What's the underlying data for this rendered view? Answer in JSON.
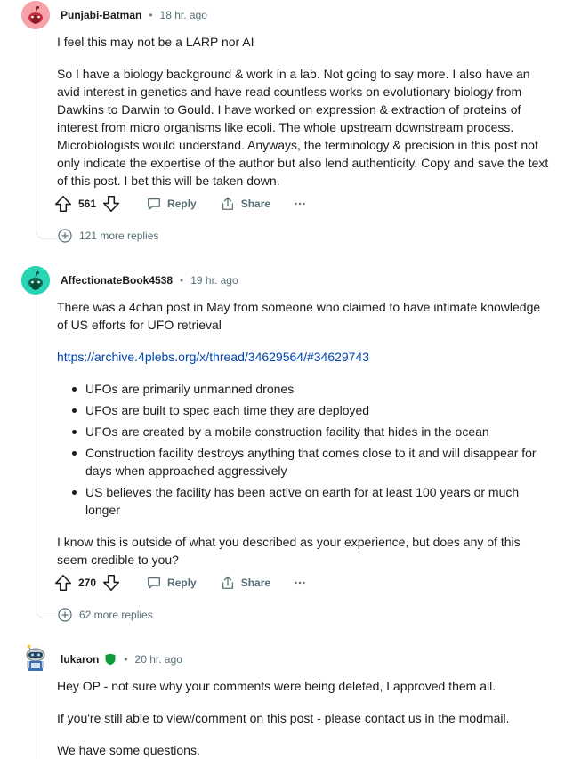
{
  "comments": [
    {
      "author": "Punjabi-Batman",
      "time": "18 hr. ago",
      "paragraphs": [
        "I feel this may not be a LARP nor AI",
        "So I have a biology background & work in a lab. Not going to say more. I also have an avid interest in genetics and have read countless works on evolutionary biology from Dawkins to Darwin to Gould. I have worked on expression & extraction of proteins of interest from micro organisms like ecoli. The whole upstream downstream process. Microbiologists would understand. Anyways, the terminology & precision in this post not only indicate the expertise of the author but also lend authenticity. Copy and save the text of this post. I bet this will be taken down."
      ],
      "votes": "561",
      "reply_label": "Reply",
      "share_label": "Share",
      "more_replies": "121 more replies",
      "avatar_color": "#f7a1a8"
    },
    {
      "author": "AffectionateBook4538",
      "time": "19 hr. ago",
      "intro": "There was a 4chan post in May from someone who claimed to have intimate knowledge of US efforts for UFO retrieval",
      "link": "https://archive.4plebs.org/x/thread/34629564/#34629743",
      "bullets": [
        "UFOs are primarily unmanned drones",
        "UFOs are built to spec each time they are deployed",
        "UFOs are created by a mobile construction facility that hides in the ocean",
        "Construction facility destroys anything that comes close to it and will disappear for days when approached aggressively",
        "US believes the facility has been active on earth for at least 100 years or much longer"
      ],
      "outro": "I know this is outside of what you described as your experience, but does any of this seem credible to you?",
      "votes": "270",
      "reply_label": "Reply",
      "share_label": "Share",
      "more_replies": "62 more replies",
      "avatar_color": "#28d4b3"
    },
    {
      "author": "lukaron",
      "time": "20 hr. ago",
      "paragraphs": [
        "Hey OP - not sure why your comments were being deleted, I approved them all.",
        "If you're still able to view/comment on this post - please contact us in the modmail.",
        "We have some questions."
      ],
      "mod_color": "#0f9a3c"
    }
  ]
}
